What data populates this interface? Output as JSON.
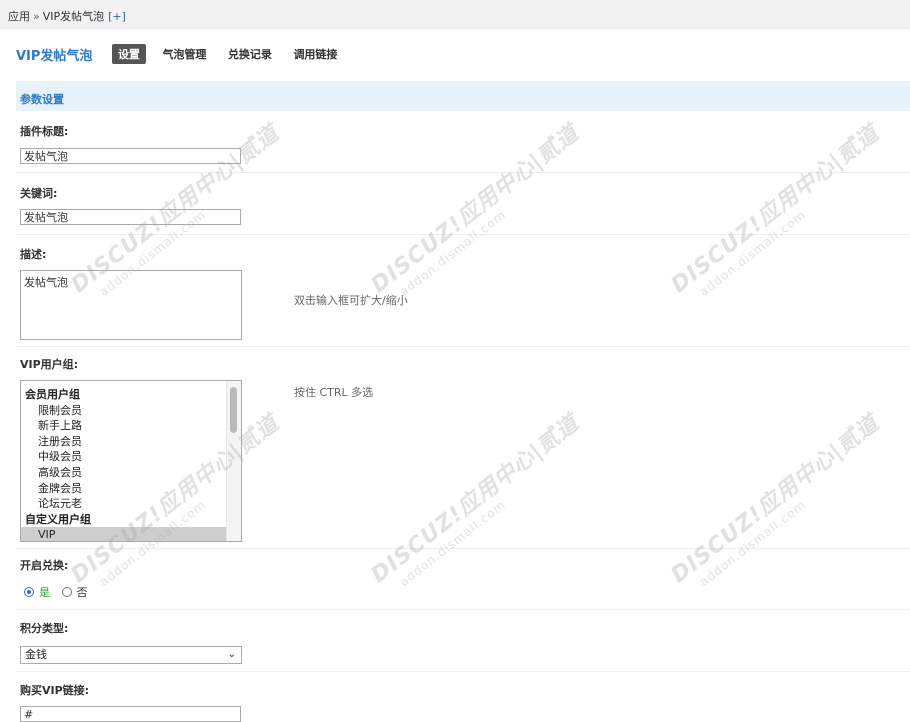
{
  "breadcrumb": {
    "root": "应用",
    "separator": "»",
    "current": "VIP发帖气泡",
    "add": "[+]"
  },
  "header": {
    "plugin_title": "VIP发帖气泡",
    "tabs": [
      {
        "label": "设置",
        "active": true
      },
      {
        "label": "气泡管理",
        "active": false
      },
      {
        "label": "兑换记录",
        "active": false
      },
      {
        "label": "调用链接",
        "active": false
      }
    ]
  },
  "section": {
    "title": "参数设置"
  },
  "fields": {
    "plugin_title": {
      "label": "插件标题:",
      "value": "发帖气泡"
    },
    "keywords": {
      "label": "关键词:",
      "value": "发帖气泡"
    },
    "description": {
      "label": "描述:",
      "value": "发帖气泡",
      "hint": "双击输入框可扩大/缩小"
    },
    "vip_groups": {
      "label": "VIP用户组:",
      "hint": "按住 CTRL 多选",
      "items": [
        {
          "text": "会员用户组",
          "type": "group",
          "selected": false
        },
        {
          "text": "限制会员",
          "type": "option",
          "selected": false
        },
        {
          "text": "新手上路",
          "type": "option",
          "selected": false
        },
        {
          "text": "注册会员",
          "type": "option",
          "selected": false
        },
        {
          "text": "中级会员",
          "type": "option",
          "selected": false
        },
        {
          "text": "高级会员",
          "type": "option",
          "selected": false
        },
        {
          "text": "金牌会员",
          "type": "option",
          "selected": false
        },
        {
          "text": "论坛元老",
          "type": "option",
          "selected": false
        },
        {
          "text": "自定义用户组",
          "type": "group",
          "selected": false
        },
        {
          "text": "VIP",
          "type": "option",
          "selected": true
        }
      ]
    },
    "enable_exchange": {
      "label": "开启兑换:",
      "yes": "是",
      "no": "否",
      "selected": "yes"
    },
    "credit_type": {
      "label": "积分类型:",
      "value": "金钱"
    },
    "buy_vip_link": {
      "label": "购买VIP链接:",
      "value": "#"
    }
  },
  "watermark": {
    "main": "DISCUZ!应用中心|贰道",
    "sub": "addon.dismall.com"
  },
  "colors": {
    "accent": "#2b7acd",
    "section_bg": "#e8f2fa",
    "active_tab_bg": "#555555",
    "radio_yes": "#2fa33a"
  }
}
